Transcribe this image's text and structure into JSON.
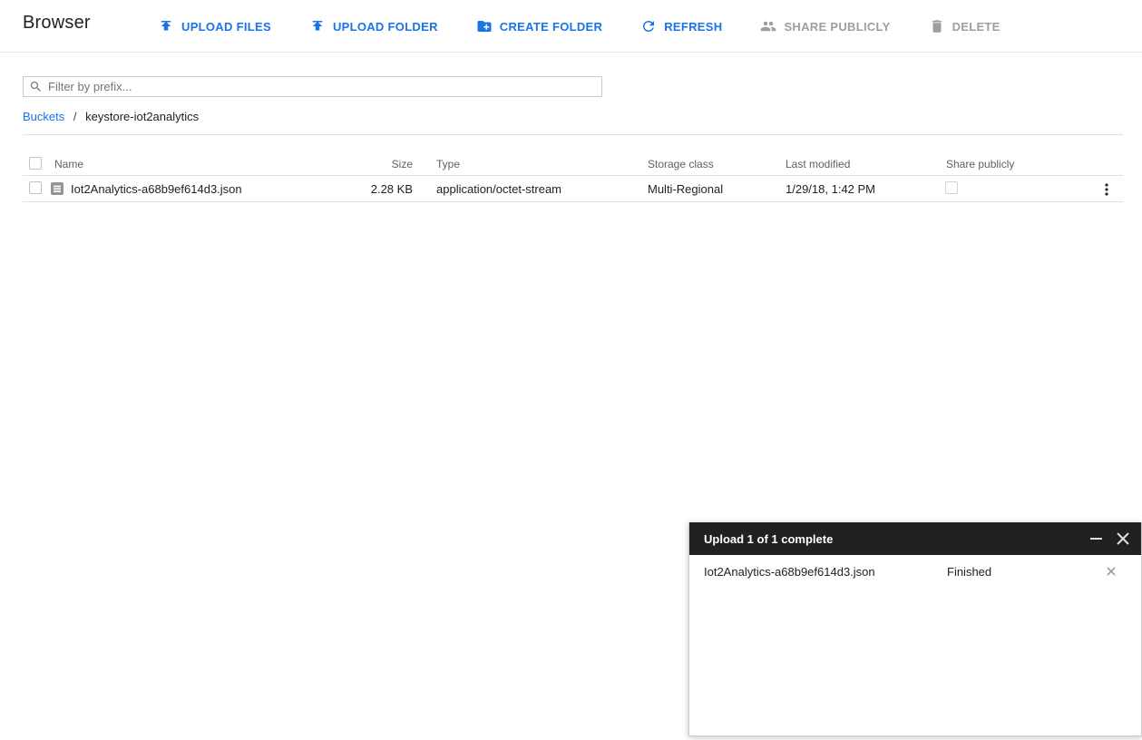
{
  "header": {
    "title": "Browser"
  },
  "toolbar": {
    "buttons": [
      {
        "label": "UPLOAD FILES",
        "icon": "upload-icon",
        "enabled": true
      },
      {
        "label": "UPLOAD FOLDER",
        "icon": "upload-icon",
        "enabled": true
      },
      {
        "label": "CREATE FOLDER",
        "icon": "create-folder-icon",
        "enabled": true
      },
      {
        "label": "REFRESH",
        "icon": "refresh-icon",
        "enabled": true
      },
      {
        "label": "SHARE PUBLICLY",
        "icon": "people-icon",
        "enabled": false
      },
      {
        "label": "DELETE",
        "icon": "trash-icon",
        "enabled": false
      }
    ]
  },
  "filter": {
    "placeholder": "Filter by prefix...",
    "value": ""
  },
  "breadcrumb": {
    "root": "Buckets",
    "separator": "/",
    "current": "keystore-iot2analytics"
  },
  "table": {
    "columns": {
      "name": "Name",
      "size": "Size",
      "type": "Type",
      "storage_class": "Storage class",
      "last_modified": "Last modified",
      "share_publicly": "Share publicly"
    },
    "rows": [
      {
        "name": "Iot2Analytics-a68b9ef614d3.json",
        "size": "2.28 KB",
        "type": "application/octet-stream",
        "storage_class": "Multi-Regional",
        "last_modified": "1/29/18, 1:42 PM",
        "share_publicly": "unchecked"
      }
    ]
  },
  "upload_dialog": {
    "title": "Upload 1 of 1 complete",
    "items": [
      {
        "name": "Iot2Analytics-a68b9ef614d3.json",
        "status": "Finished"
      }
    ]
  },
  "colors": {
    "accent_blue": "#1a73e8",
    "disabled_gray": "#9e9e9e",
    "dialog_header_bg": "#212121",
    "divider": "#e0e0e0"
  }
}
